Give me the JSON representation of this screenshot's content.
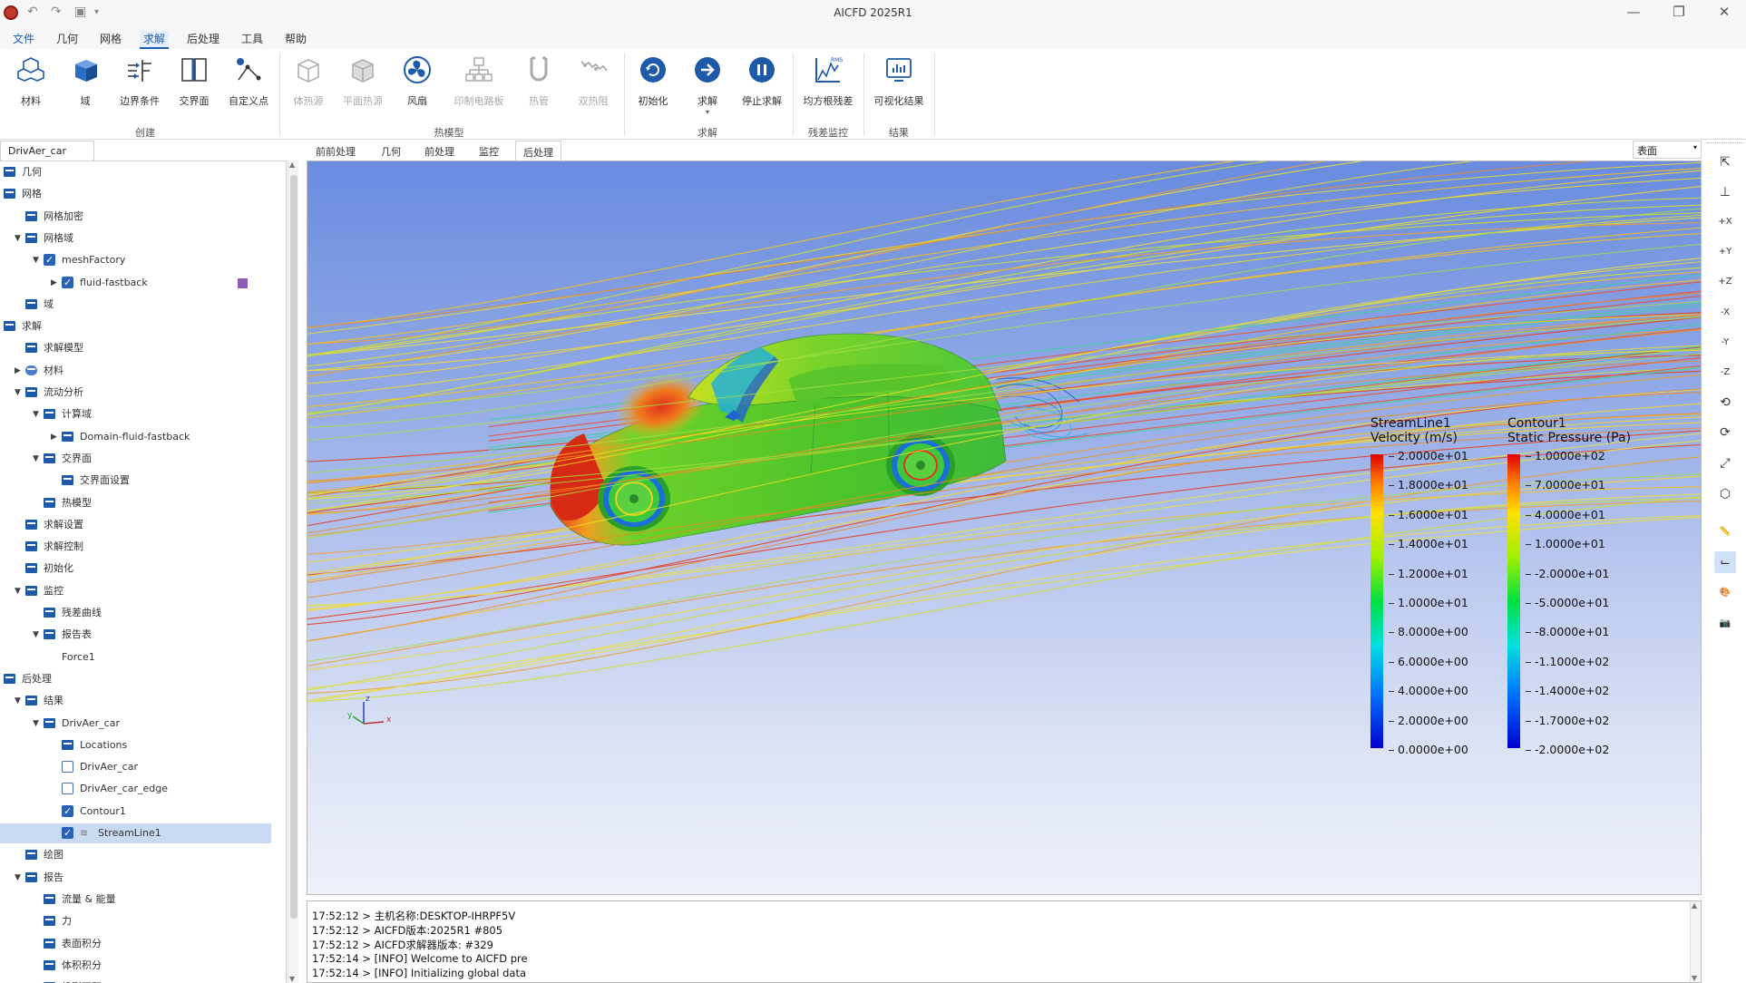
{
  "window": {
    "title": "AICFD 2025R1"
  },
  "menu": [
    "文件",
    "几何",
    "网格",
    "求解",
    "后处理",
    "工具",
    "帮助"
  ],
  "ribbon": {
    "buttons": [
      "材料",
      "域",
      "边界条件",
      "交界面",
      "自定义点",
      "体热源",
      "平面热源",
      "风扇",
      "印制电路板",
      "热管",
      "双热阻",
      "初始化",
      "求解",
      "停止求解",
      "均方根残差",
      "可视化结果"
    ],
    "groups": [
      "创建",
      "热模型",
      "求解",
      "残差监控",
      "结果"
    ]
  },
  "left_panel": {
    "tab": "DrivAer_car"
  },
  "tree": [
    {
      "label": "几何",
      "depth": 0,
      "arrow": "down",
      "icon": "folder"
    },
    {
      "label": "网格",
      "depth": 0,
      "arrow": "down",
      "icon": "folder"
    },
    {
      "label": "网格加密",
      "depth": 1,
      "arrow": "",
      "icon": "folder"
    },
    {
      "label": "网格域",
      "depth": 1,
      "arrow": "down",
      "icon": "folder"
    },
    {
      "label": "meshFactory",
      "depth": 2,
      "arrow": "down",
      "icon": "check"
    },
    {
      "label": "fluid-fastback",
      "depth": 3,
      "arrow": "right",
      "icon": "check"
    },
    {
      "label": "域",
      "depth": 1,
      "arrow": "",
      "icon": "folder"
    },
    {
      "label": "求解",
      "depth": 0,
      "arrow": "down",
      "icon": "folder"
    },
    {
      "label": "求解模型",
      "depth": 1,
      "arrow": "",
      "icon": "folder"
    },
    {
      "label": "材料",
      "depth": 1,
      "arrow": "right",
      "icon": "material"
    },
    {
      "label": "流动分析",
      "depth": 1,
      "arrow": "down",
      "icon": "folder"
    },
    {
      "label": "计算域",
      "depth": 2,
      "arrow": "down",
      "icon": "folder"
    },
    {
      "label": "Domain-fluid-fastback",
      "depth": 3,
      "arrow": "right",
      "icon": "folder"
    },
    {
      "label": "交界面",
      "depth": 2,
      "arrow": "down",
      "icon": "folder"
    },
    {
      "label": "交界面设置",
      "depth": 3,
      "arrow": "",
      "icon": "folder"
    },
    {
      "label": "热模型",
      "depth": 2,
      "arrow": "",
      "icon": "folder"
    },
    {
      "label": "求解设置",
      "depth": 1,
      "arrow": "",
      "icon": "folder"
    },
    {
      "label": "求解控制",
      "depth": 1,
      "arrow": "",
      "icon": "folder"
    },
    {
      "label": "初始化",
      "depth": 1,
      "arrow": "",
      "icon": "folder"
    },
    {
      "label": "监控",
      "depth": 1,
      "arrow": "down",
      "icon": "folder"
    },
    {
      "label": "残差曲线",
      "depth": 2,
      "arrow": "",
      "icon": "folder"
    },
    {
      "label": "报告表",
      "depth": 2,
      "arrow": "down",
      "icon": "folder"
    },
    {
      "label": "Force1",
      "depth": 3,
      "arrow": "",
      "icon": ""
    },
    {
      "label": "后处理",
      "depth": 0,
      "arrow": "down",
      "icon": "folder"
    },
    {
      "label": "结果",
      "depth": 1,
      "arrow": "down",
      "icon": "folder"
    },
    {
      "label": "DrivAer_car",
      "depth": 2,
      "arrow": "down",
      "icon": "folder"
    },
    {
      "label": "Locations",
      "depth": 3,
      "arrow": "",
      "icon": "folder"
    },
    {
      "label": "DrivAer_car",
      "depth": 3,
      "arrow": "",
      "icon": "uncheck"
    },
    {
      "label": "DrivAer_car_edge",
      "depth": 3,
      "arrow": "",
      "icon": "uncheck"
    },
    {
      "label": "Contour1",
      "depth": 3,
      "arrow": "",
      "icon": "check"
    },
    {
      "label": "StreamLine1",
      "depth": 3,
      "arrow": "",
      "icon": "check",
      "selected": true
    },
    {
      "label": "绘图",
      "depth": 1,
      "arrow": "",
      "icon": "folder"
    },
    {
      "label": "报告",
      "depth": 1,
      "arrow": "down",
      "icon": "folder"
    },
    {
      "label": "流量 & 能量",
      "depth": 2,
      "arrow": "",
      "icon": "folder"
    },
    {
      "label": "力",
      "depth": 2,
      "arrow": "",
      "icon": "folder"
    },
    {
      "label": "表面积分",
      "depth": 2,
      "arrow": "",
      "icon": "folder"
    },
    {
      "label": "体积积分",
      "depth": 2,
      "arrow": "",
      "icon": "folder"
    },
    {
      "label": "投影面积",
      "depth": 2,
      "arrow": "",
      "icon": "folder"
    }
  ],
  "viewport_tabs": [
    "前前处理",
    "几何",
    "前处理",
    "监控",
    "后处理"
  ],
  "view_mode": "表面",
  "legend_velocity": {
    "title1": "StreamLine1",
    "title2": "Velocity (m/s)",
    "ticks": [
      "2.0000e+01",
      "1.8000e+01",
      "1.6000e+01",
      "1.4000e+01",
      "1.2000e+01",
      "1.0000e+01",
      "8.0000e+00",
      "6.0000e+00",
      "4.0000e+00",
      "2.0000e+00",
      "0.0000e+00"
    ]
  },
  "legend_pressure": {
    "title1": "Contour1",
    "title2": "Static Pressure (Pa)",
    "ticks": [
      "1.0000e+02",
      "7.0000e+01",
      "4.0000e+01",
      "1.0000e+01",
      "-2.0000e+01",
      "-5.0000e+01",
      "-8.0000e+01",
      "-1.1000e+02",
      "-1.4000e+02",
      "-1.7000e+02",
      "-2.0000e+02"
    ]
  },
  "axis_triad": {
    "x": "x",
    "y": "y",
    "z": "z"
  },
  "console": [
    "17:52:12 > 主机名称:DESKTOP-IHRPF5V",
    "17:52:12 > AICFD版本:2025R1 #805",
    "17:52:12 > AICFD求解器版本: #329",
    "17:52:14 > [INFO] Welcome to AICFD pre",
    "17:52:14 > [INFO] Initializing global data"
  ],
  "colors": {
    "accent": "#1a5fb4",
    "tree_icon": "#1f5aa8",
    "selected_row": "#c9daf3",
    "mesh_color_swatch": "#8e5bb5"
  },
  "right_toolbar_icons": [
    "pop-out-icon",
    "axes-icon",
    "view-plus-x-icon",
    "view-plus-y-icon",
    "view-plus-z-icon",
    "view-minus-x-icon",
    "view-minus-y-icon",
    "view-minus-z-icon",
    "rotate-ccw-90-icon",
    "rotate-cw-90-icon",
    "fit-view-icon",
    "iso-cube-icon",
    "ruler-icon",
    "axis-toggle-icon",
    "palette-icon",
    "camera-icon"
  ]
}
